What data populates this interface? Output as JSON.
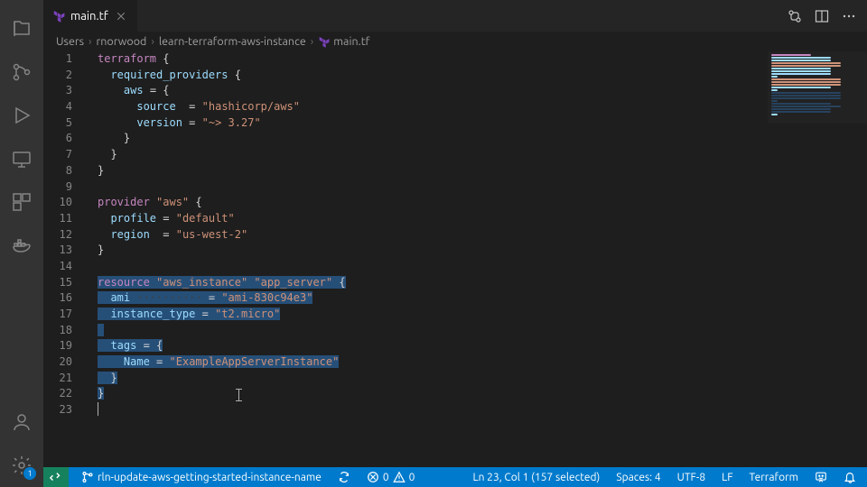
{
  "tab": {
    "filename": "main.tf",
    "icon": "terraform"
  },
  "breadcrumbs": [
    "Users",
    "rnorwood",
    "learn-terraform-aws-instance",
    "main.tf"
  ],
  "editor": {
    "lines": [
      {
        "n": 1,
        "sel": false,
        "tokens": [
          [
            "kw",
            "terraform"
          ],
          [
            "punc",
            " {"
          ]
        ]
      },
      {
        "n": 2,
        "sel": false,
        "tokens": [
          [
            "punc",
            "  "
          ],
          [
            "id",
            "required_providers"
          ],
          [
            "punc",
            " {"
          ]
        ]
      },
      {
        "n": 3,
        "sel": false,
        "tokens": [
          [
            "punc",
            "    "
          ],
          [
            "id",
            "aws"
          ],
          [
            "punc",
            " "
          ],
          [
            "op",
            "="
          ],
          [
            "punc",
            " {"
          ]
        ]
      },
      {
        "n": 4,
        "sel": false,
        "tokens": [
          [
            "punc",
            "      "
          ],
          [
            "id",
            "source"
          ],
          [
            "punc",
            "  "
          ],
          [
            "op",
            "="
          ],
          [
            "punc",
            " "
          ],
          [
            "str",
            "\"hashicorp/aws\""
          ]
        ]
      },
      {
        "n": 5,
        "sel": false,
        "tokens": [
          [
            "punc",
            "      "
          ],
          [
            "id",
            "version"
          ],
          [
            "punc",
            " "
          ],
          [
            "op",
            "="
          ],
          [
            "punc",
            " "
          ],
          [
            "str",
            "\"~> 3.27\""
          ]
        ]
      },
      {
        "n": 6,
        "sel": false,
        "tokens": [
          [
            "punc",
            "    }"
          ]
        ]
      },
      {
        "n": 7,
        "sel": false,
        "tokens": [
          [
            "punc",
            "  }"
          ]
        ]
      },
      {
        "n": 8,
        "sel": false,
        "tokens": [
          [
            "punc",
            "}"
          ]
        ]
      },
      {
        "n": 9,
        "sel": false,
        "tokens": []
      },
      {
        "n": 10,
        "sel": false,
        "tokens": [
          [
            "kw",
            "provider"
          ],
          [
            "punc",
            " "
          ],
          [
            "str",
            "\"aws\""
          ],
          [
            "punc",
            " {"
          ]
        ]
      },
      {
        "n": 11,
        "sel": false,
        "tokens": [
          [
            "punc",
            "  "
          ],
          [
            "id",
            "profile"
          ],
          [
            "punc",
            " "
          ],
          [
            "op",
            "="
          ],
          [
            "punc",
            " "
          ],
          [
            "str",
            "\"default\""
          ]
        ]
      },
      {
        "n": 12,
        "sel": false,
        "tokens": [
          [
            "punc",
            "  "
          ],
          [
            "id",
            "region"
          ],
          [
            "punc",
            "  "
          ],
          [
            "op",
            "="
          ],
          [
            "punc",
            " "
          ],
          [
            "str",
            "\"us-west-2\""
          ]
        ]
      },
      {
        "n": 13,
        "sel": false,
        "tokens": [
          [
            "punc",
            "}"
          ]
        ]
      },
      {
        "n": 14,
        "sel": false,
        "tokens": []
      },
      {
        "n": 15,
        "sel": true,
        "tokens": [
          [
            "kw",
            "resource"
          ],
          [
            "punc",
            " "
          ],
          [
            "str",
            "\"aws_instance\""
          ],
          [
            "punc",
            " "
          ],
          [
            "str",
            "\"app_server\""
          ],
          [
            "punc",
            " {"
          ]
        ]
      },
      {
        "n": 16,
        "sel": true,
        "tokens": [
          [
            "punc",
            "  "
          ],
          [
            "id",
            "ami"
          ],
          [
            "guide",
            " ·········· "
          ],
          [
            "op",
            "="
          ],
          [
            "punc",
            " "
          ],
          [
            "str",
            "\"ami-830c94e3\""
          ]
        ]
      },
      {
        "n": 17,
        "sel": true,
        "tokens": [
          [
            "punc",
            "  "
          ],
          [
            "id",
            "instance_type"
          ],
          [
            "punc",
            " "
          ],
          [
            "op",
            "="
          ],
          [
            "punc",
            " "
          ],
          [
            "str",
            "\"t2.micro\""
          ]
        ]
      },
      {
        "n": 18,
        "sel": true,
        "tokens": []
      },
      {
        "n": 19,
        "sel": true,
        "tokens": [
          [
            "punc",
            "  "
          ],
          [
            "id",
            "tags"
          ],
          [
            "punc",
            " "
          ],
          [
            "op",
            "="
          ],
          [
            "punc",
            " {"
          ]
        ]
      },
      {
        "n": 20,
        "sel": true,
        "tokens": [
          [
            "punc",
            "    "
          ],
          [
            "id",
            "Name"
          ],
          [
            "punc",
            " "
          ],
          [
            "op",
            "="
          ],
          [
            "punc",
            " "
          ],
          [
            "str",
            "\"ExampleAppServerInstance\""
          ]
        ]
      },
      {
        "n": 21,
        "sel": true,
        "tokens": [
          [
            "punc",
            "  }"
          ]
        ]
      },
      {
        "n": 22,
        "sel": true,
        "tokens": [
          [
            "punc",
            "}"
          ]
        ]
      },
      {
        "n": 23,
        "sel": false,
        "tokens": []
      }
    ]
  },
  "status": {
    "branch_icon": "⎇",
    "branch": "rln-update-aws-getting-started-instance-name",
    "sync_icon": "⟳",
    "errors_icon": "⊘",
    "errors": "0",
    "warnings_icon": "⚠",
    "warnings": "0",
    "selection": "Ln 23, Col 1 (157 selected)",
    "spaces": "Spaces: 4",
    "encoding": "UTF-8",
    "eol": "LF",
    "language": "Terraform",
    "feedback_icon": "☺",
    "bell_icon": "🔔"
  },
  "settings_badge": "1"
}
